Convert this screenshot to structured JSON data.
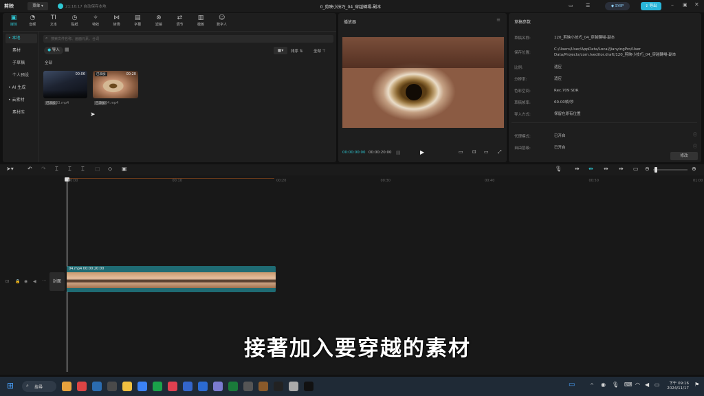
{
  "titlebar": {
    "app_name": "剪映",
    "menu_label": "菜单",
    "autosave": "21:16:17  自动保存本地",
    "project_title": "0_剪映小技巧_04_穿越轉場-副本",
    "vip_label": "SVIP",
    "export_label": "导出"
  },
  "toolbar": {
    "tools": [
      {
        "label": "媒体",
        "icon": "▣"
      },
      {
        "label": "音频",
        "icon": "◔"
      },
      {
        "label": "文本",
        "icon": "TI"
      },
      {
        "label": "贴纸",
        "icon": "◷"
      },
      {
        "label": "特效",
        "icon": "✧"
      },
      {
        "label": "转场",
        "icon": "⋈"
      },
      {
        "label": "字幕",
        "icon": "▤"
      },
      {
        "label": "滤镜",
        "icon": "⊗"
      },
      {
        "label": "调节",
        "icon": "⇄"
      },
      {
        "label": "模板",
        "icon": "▥"
      },
      {
        "label": "数字人",
        "icon": "☺"
      }
    ]
  },
  "sidebar": {
    "items": [
      "• 本地",
      "素材",
      "子草稿",
      "个人预设",
      "• AI 生成",
      "• 云素材",
      "素材库"
    ]
  },
  "media": {
    "search_placeholder": "搜索文件名称、画面元素、台词",
    "import_label": "导入",
    "sort_label": "排序",
    "filter_label": "全部",
    "section_label": "全部",
    "clips": [
      {
        "duration": "00:06",
        "name": "03.mp4",
        "tag": "已添加"
      },
      {
        "duration": "00:20",
        "name": "04.mp4",
        "tag": "已添加",
        "badge": "已添加"
      }
    ]
  },
  "player": {
    "title": "播放器",
    "current_time": "00:00:00:00",
    "total_time": "00:00:20:00"
  },
  "params": {
    "title": "草稿参数",
    "rows": [
      {
        "k": "草稿名称:",
        "v": "120_剪映小技巧_04_穿越轉場-副本"
      },
      {
        "k": "保存位置:",
        "v": "C:/Users/User/AppData/Local/JianyingPro/User Data/Projects/com.lveditor.draft/120_剪映小技巧_04_穿越轉場-副本"
      },
      {
        "k": "比例:",
        "v": "适应"
      },
      {
        "k": "分辨率:",
        "v": "适应"
      },
      {
        "k": "色彩空间:",
        "v": "Rec.709 SDR"
      },
      {
        "k": "草稿帧率:",
        "v": "60.00帧/秒"
      },
      {
        "k": "导入方式:",
        "v": "保留在原有位置"
      },
      {
        "k": "代理模式:",
        "v": "已开启"
      },
      {
        "k": "自由层级:",
        "v": "已开启"
      }
    ],
    "edit_label": "修改"
  },
  "timeline": {
    "ticks": [
      "00:00",
      "00:10",
      "00:20",
      "00:30",
      "00:40",
      "00:50",
      "01:00"
    ],
    "clip_label": "04.mp4  00:00:20:00",
    "cover_label": "封面"
  },
  "subtitle": "接著加入要穿越的素材",
  "taskbar": {
    "search_label": "搜尋",
    "time": "下午 09:16",
    "date": "2024/11/17"
  },
  "colors": {
    "accent": "#2ec7d3",
    "clip": "#1f6b73",
    "export": "#29b6d9"
  }
}
